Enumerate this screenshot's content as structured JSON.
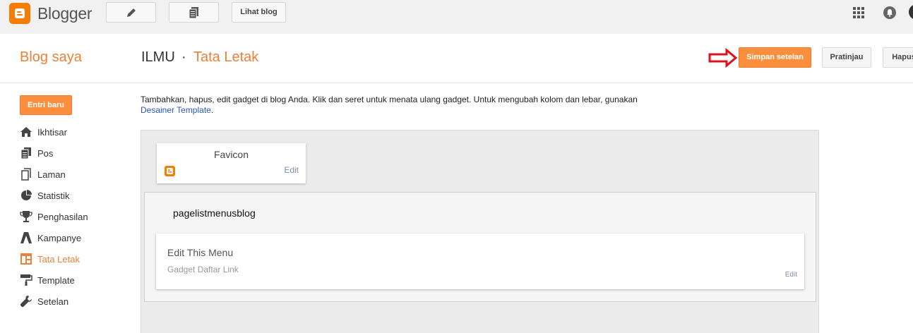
{
  "topbar": {
    "brand": "Blogger",
    "view_blog_label": "Lihat blog"
  },
  "header": {
    "sidebar_title": "Blog saya",
    "blog_name": "ILMU",
    "separator": "·",
    "page_title": "Tata Letak",
    "save_label": "Simpan setelan",
    "preview_label": "Pratinjau",
    "delete_label": "Hapus"
  },
  "sidebar": {
    "new_post_label": "Entri baru",
    "items": [
      {
        "label": "Ikhtisar",
        "icon": "home-icon"
      },
      {
        "label": "Pos",
        "icon": "posts-icon"
      },
      {
        "label": "Laman",
        "icon": "pages-icon"
      },
      {
        "label": "Statistik",
        "icon": "stats-icon"
      },
      {
        "label": "Penghasilan",
        "icon": "trophy-icon"
      },
      {
        "label": "Kampanye",
        "icon": "campaign-icon"
      },
      {
        "label": "Tata Letak",
        "icon": "layout-icon",
        "active": true
      },
      {
        "label": "Template",
        "icon": "paint-roller-icon"
      },
      {
        "label": "Setelan",
        "icon": "wrench-icon"
      }
    ]
  },
  "main": {
    "description": "Tambahkan, hapus, edit gadget di blog Anda. Klik dan seret untuk menata ulang gadget. Untuk mengubah kolom dan lebar, gunakan",
    "description_link": "Desainer Template",
    "description_end": ".",
    "favicon_gadget": {
      "title": "Favicon",
      "edit": "Edit"
    },
    "section_title": "pagelistmenusblog",
    "menu_gadget": {
      "title": "Edit This Menu",
      "subtitle": "Gadget Daftar Link",
      "edit": "Edit"
    }
  },
  "colors": {
    "accent": "#fb8f3d",
    "link": "#2a56c6",
    "arrow": "#e0111b"
  }
}
